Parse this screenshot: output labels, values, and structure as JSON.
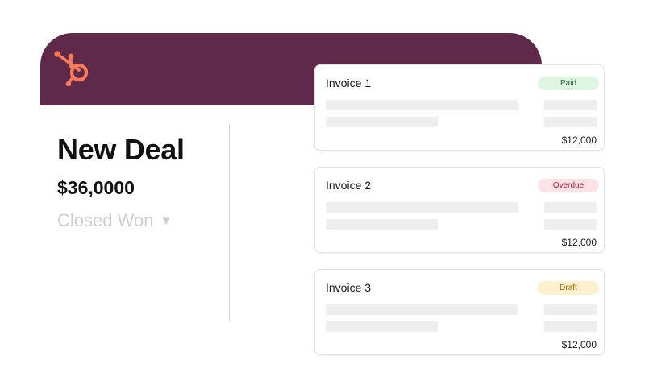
{
  "brand": {
    "icon": "hubspot-sprocket-icon",
    "header_color": "#5f2a4a",
    "accent_color": "#ff7a59"
  },
  "deal": {
    "title": "New Deal",
    "amount": "$36,0000",
    "stage": "Closed Won",
    "stage_caret": "▼"
  },
  "invoices": [
    {
      "title": "Invoice 1",
      "status": "Paid",
      "amount": "$12,000",
      "status_bg": "#dff5e4",
      "status_fg": "#1f6b3a"
    },
    {
      "title": "Invoice 2",
      "status": "Overdue",
      "amount": "$12,000",
      "status_bg": "#fde3e6",
      "status_fg": "#b0173a"
    },
    {
      "title": "Invoice 3",
      "status": "Draft",
      "amount": "$12,000",
      "status_bg": "#fdf0cf",
      "status_fg": "#a06a00"
    }
  ]
}
